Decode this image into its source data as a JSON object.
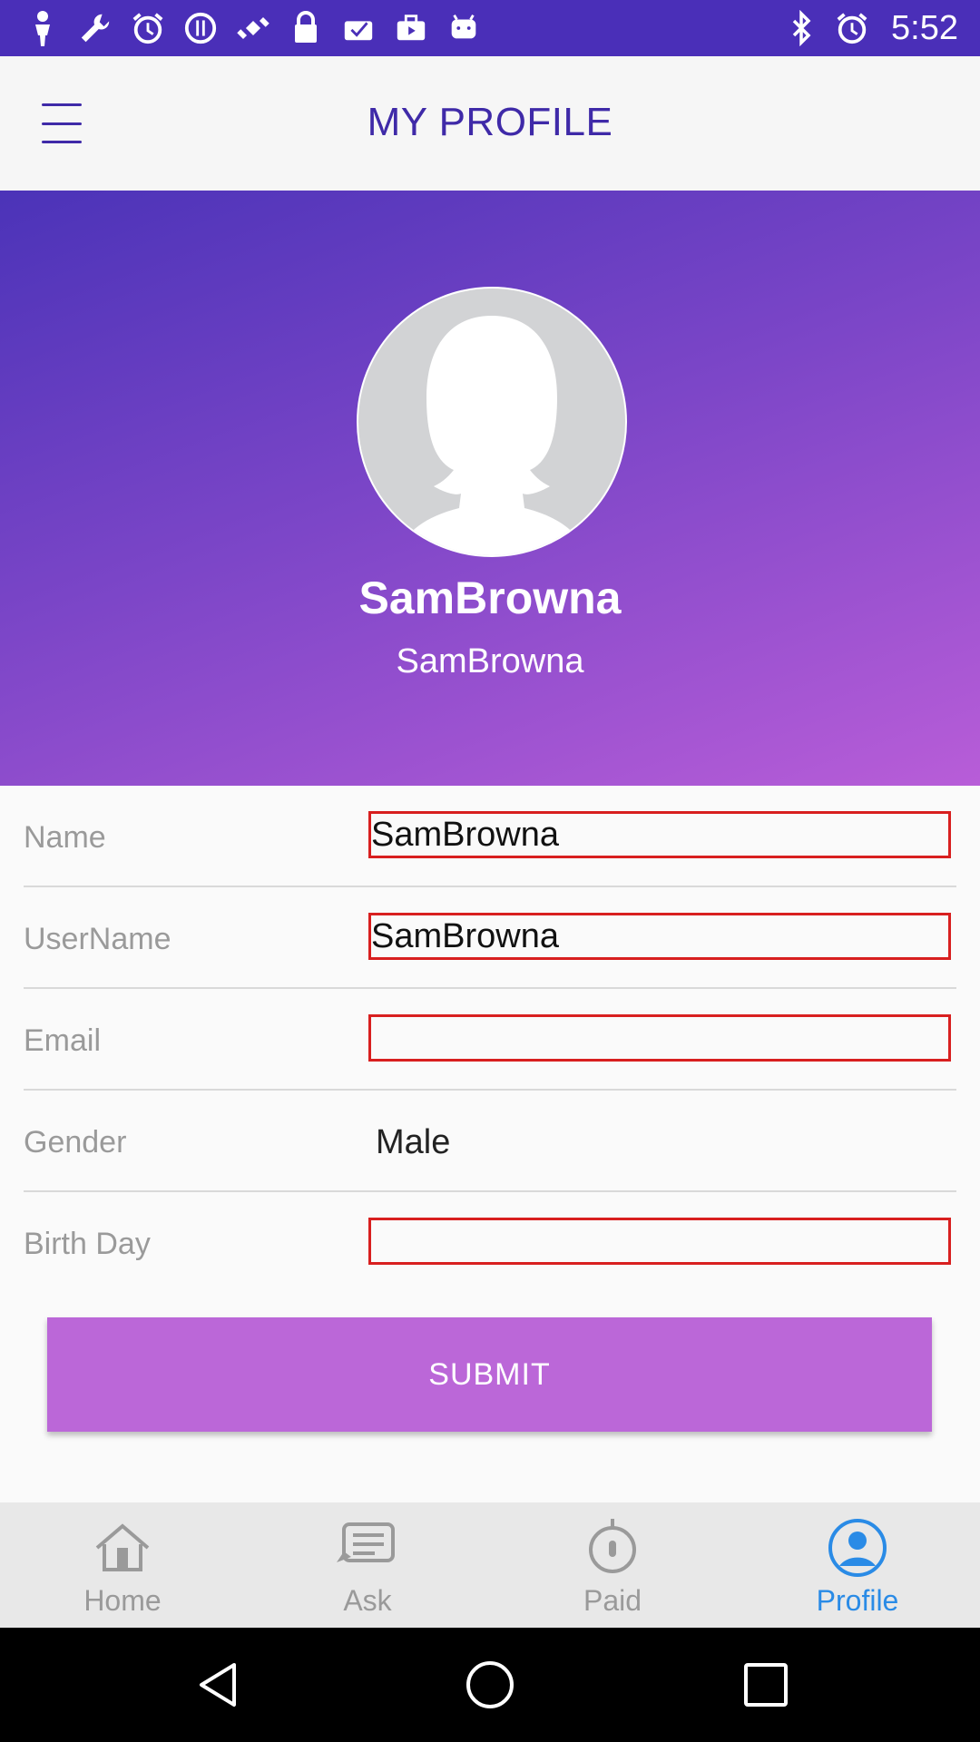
{
  "status_bar": {
    "time": "5:52",
    "left_icons": [
      "person-icon",
      "wrench-icon",
      "alarm-icon",
      "info-icon",
      "satellite-icon",
      "lock-icon",
      "checkmark-icon",
      "briefcase-icon",
      "android-icon"
    ],
    "right_icons": [
      "bluetooth-icon",
      "alarm-icon"
    ]
  },
  "app_bar": {
    "title": "MY PROFILE"
  },
  "header": {
    "display_name": "SamBrowna",
    "display_username": "SamBrowna"
  },
  "form": {
    "name": {
      "label": "Name",
      "value": "SamBrowna"
    },
    "username": {
      "label": "UserName",
      "value": "SamBrowna"
    },
    "email": {
      "label": "Email",
      "value": ""
    },
    "gender": {
      "label": "Gender",
      "value": "Male"
    },
    "birthday": {
      "label": "Birth Day",
      "value": ""
    }
  },
  "submit_label": "SUBMIT",
  "bottom_nav": {
    "items": [
      {
        "label": "Home",
        "icon": "home-icon"
      },
      {
        "label": "Ask",
        "icon": "chat-icon"
      },
      {
        "label": "Paid",
        "icon": "mouse-icon"
      },
      {
        "label": "Profile",
        "icon": "profile-icon"
      }
    ],
    "active": "Profile"
  },
  "colors": {
    "primary": "#3f2aa8",
    "accent": "#bb67d8",
    "active_nav": "#2a8be6",
    "field_border": "#d81f1f"
  }
}
